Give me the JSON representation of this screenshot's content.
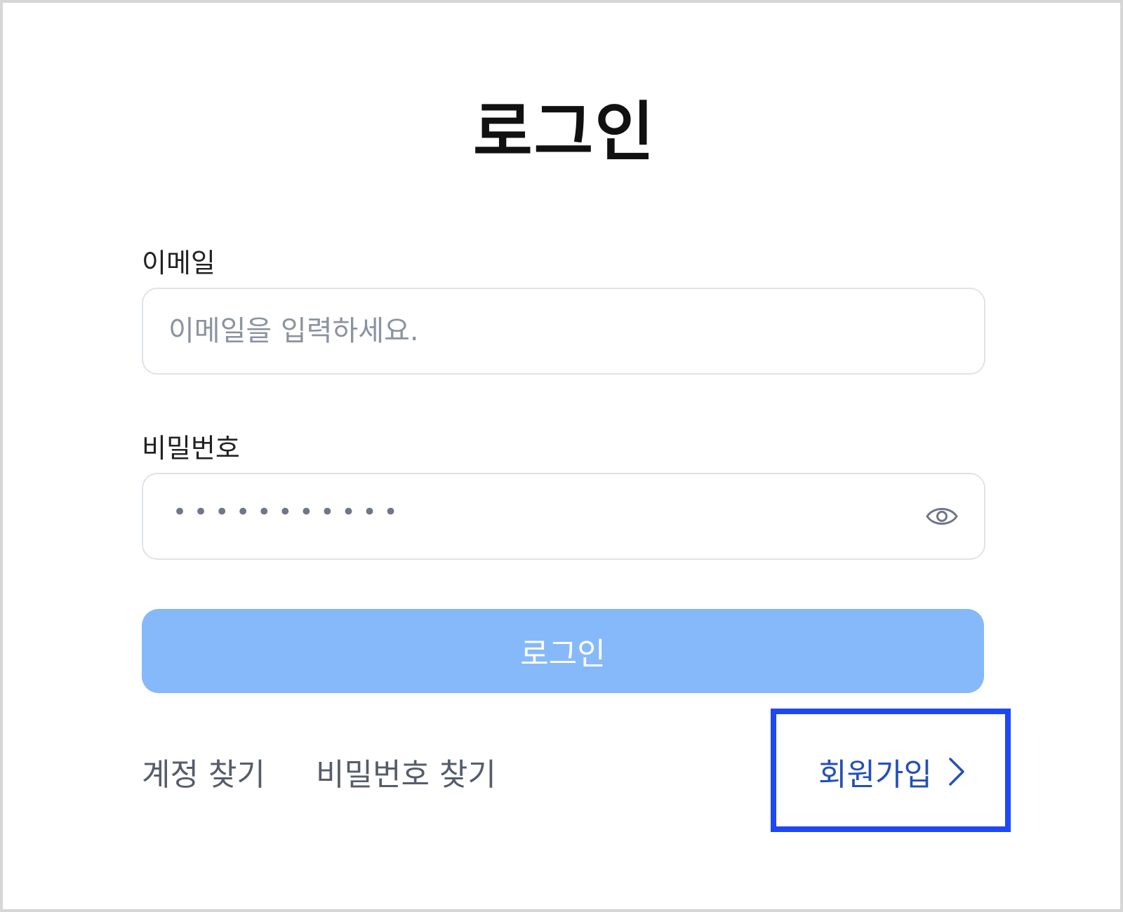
{
  "page": {
    "title": "로그인"
  },
  "form": {
    "email_label": "이메일",
    "email_placeholder": "이메일을 입력하세요.",
    "email_value": "",
    "password_label": "비밀번호",
    "password_masked": "•••••••••••",
    "password_toggle_icon": "eye-icon",
    "login_button": "로그인"
  },
  "links": {
    "find_account": "계정 찾기",
    "find_password": "비밀번호 찾기",
    "signup": "회원가입",
    "signup_icon": "chevron-right-icon"
  },
  "colors": {
    "login_button_bg": "#86b9fa",
    "signup_link": "#2350b8",
    "highlight_border": "#1e47f5"
  }
}
